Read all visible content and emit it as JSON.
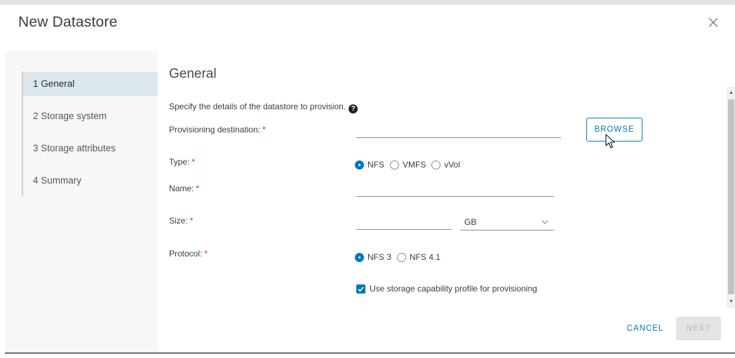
{
  "dialog": {
    "title": "New Datastore"
  },
  "steps": [
    {
      "label": "1  General",
      "active": true
    },
    {
      "label": "2  Storage system",
      "active": false
    },
    {
      "label": "3  Storage attributes",
      "active": false
    },
    {
      "label": "4  Summary",
      "active": false
    }
  ],
  "main": {
    "heading": "General",
    "description": "Specify the details of the datastore to provision.",
    "help_glyph": "?"
  },
  "form": {
    "destination": {
      "label": "Provisioning destination:",
      "required": "*",
      "value": "",
      "placeholder": ""
    },
    "browse_label": "BROWSE",
    "type": {
      "label": "Type:",
      "required": "*",
      "options": [
        "NFS",
        "VMFS",
        "vVol"
      ],
      "selected": "NFS"
    },
    "name": {
      "label": "Name:",
      "required": "*",
      "value": "",
      "placeholder": ""
    },
    "size": {
      "label": "Size:",
      "required": "*",
      "value": "",
      "placeholder": "",
      "unit": "GB"
    },
    "protocol": {
      "label": "Protocol:",
      "required": "*",
      "options": [
        "NFS 3",
        "NFS 4.1"
      ],
      "selected": "NFS 3"
    },
    "capability_profile": {
      "label": "Use storage capability profile for provisioning",
      "checked": true
    }
  },
  "footer": {
    "cancel_label": "CANCEL",
    "next_label": "NEXT"
  },
  "colors": {
    "accent": "#0079b8",
    "required": "#e02020",
    "active_step_bg": "#dde7ee"
  },
  "icons": {
    "close": "close-icon",
    "help": "help-circle-icon",
    "dropdown": "chevron-down-icon",
    "checkbox": "checkmark-icon",
    "cursor": "mouse-pointer-icon"
  }
}
